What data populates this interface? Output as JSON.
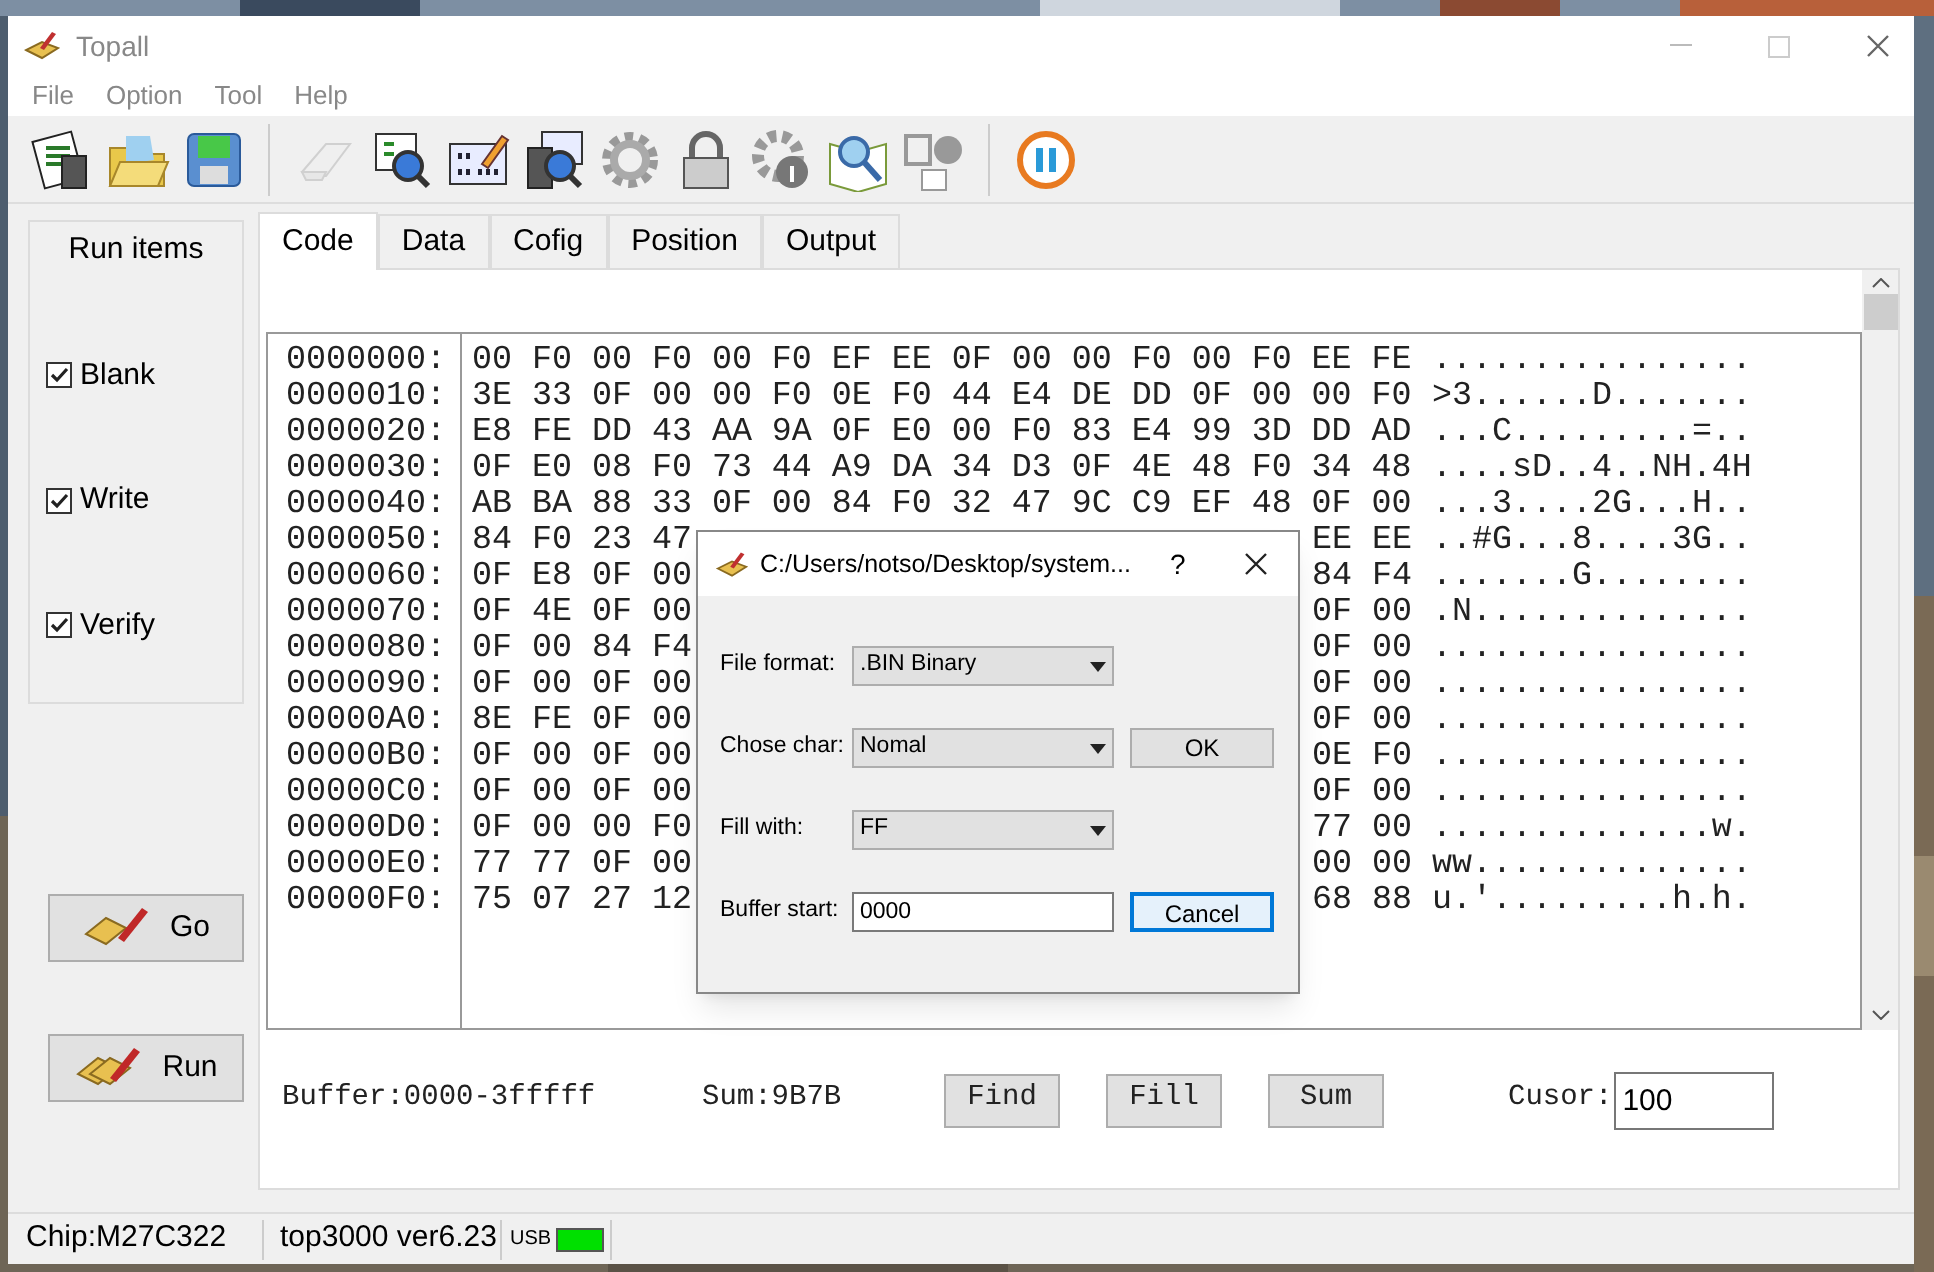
{
  "window": {
    "title": "Topall"
  },
  "menu": [
    "File",
    "Option",
    "Tool",
    "Help"
  ],
  "toolbar": [
    {
      "kind": "chip-list",
      "disabled": false
    },
    {
      "kind": "folder",
      "disabled": false
    },
    {
      "kind": "floppy",
      "disabled": false
    },
    {
      "kind": "separator"
    },
    {
      "kind": "eraser",
      "disabled": true
    },
    {
      "kind": "doc-search",
      "disabled": false
    },
    {
      "kind": "binary-edit",
      "disabled": false
    },
    {
      "kind": "chip-search",
      "disabled": false
    },
    {
      "kind": "gear",
      "disabled": false
    },
    {
      "kind": "lock",
      "disabled": false
    },
    {
      "kind": "gear-info",
      "disabled": false
    },
    {
      "kind": "book-search",
      "disabled": false
    },
    {
      "kind": "logos",
      "disabled": false
    },
    {
      "kind": "separator"
    },
    {
      "kind": "pause",
      "disabled": false
    }
  ],
  "run_items": {
    "title": "Run items",
    "items": [
      {
        "label": "Blank",
        "checked": true
      },
      {
        "label": "Write",
        "checked": true
      },
      {
        "label": "Verify",
        "checked": true
      }
    ]
  },
  "actions": [
    {
      "kind": "go",
      "label": "Go"
    },
    {
      "kind": "run",
      "label": "Run"
    }
  ],
  "tabs": [
    {
      "label": "Code",
      "selected": true
    },
    {
      "label": "Data",
      "selected": false
    },
    {
      "label": "Cofig",
      "selected": false
    },
    {
      "label": "Position",
      "selected": false
    },
    {
      "label": "Output",
      "selected": false
    }
  ],
  "hex_rows": [
    {
      "offset": "0000000:",
      "hex": "00 F0 00 F0 00 F0 EF EE 0F 00 00 F0 00 F0 EE FE",
      "ascii": "................"
    },
    {
      "offset": "0000010:",
      "hex": "3E 33 0F 00 00 F0 0E F0 44 E4 DE DD 0F 00 00 F0",
      "ascii": ">3......D......."
    },
    {
      "offset": "0000020:",
      "hex": "E8 FE DD 43 AA 9A 0F E0 00 F0 83 E4 99 3D DD AD",
      "ascii": "...C.........=.."
    },
    {
      "offset": "0000030:",
      "hex": "0F E0 08 F0 73 44 A9 DA 34 D3 0F 4E 48 F0 34 48",
      "ascii": "....sD..4..NH.4H"
    },
    {
      "offset": "0000040:",
      "hex": "AB BA 88 33 0F 00 84 F0 32 47 9C C9 EF 48 0F 00",
      "ascii": "...3....2G...H.."
    },
    {
      "offset": "0000050:",
      "hex_left": "84 F0 23 47",
      "hex_right": "EE EE",
      "ascii": "..#G...8....3G.."
    },
    {
      "offset": "0000060:",
      "hex_left": "0F E8 0F 00",
      "hex_right": "84 F4",
      "ascii": ".......G........"
    },
    {
      "offset": "0000070:",
      "hex_left": "0F 4E 0F 00",
      "hex_right": "0F 00",
      "ascii": ".N.............."
    },
    {
      "offset": "0000080:",
      "hex_left": "0F 00 84 F4",
      "hex_right": "0F 00",
      "ascii": "................"
    },
    {
      "offset": "0000090:",
      "hex_left": "0F 00 0F 00",
      "hex_right": "0F 00",
      "ascii": "................"
    },
    {
      "offset": "00000A0:",
      "hex_left": "8E FE 0F 00",
      "hex_right": "0F 00",
      "ascii": "................"
    },
    {
      "offset": "00000B0:",
      "hex_left": "0F 00 0F 00",
      "hex_right": "0E F0",
      "ascii": "................"
    },
    {
      "offset": "00000C0:",
      "hex_left": "0F 00 0F 00",
      "hex_right": "0F 00",
      "ascii": "................"
    },
    {
      "offset": "00000D0:",
      "hex_left": "0F 00 00 F0",
      "hex_right": "77 00",
      "ascii": "..............w."
    },
    {
      "offset": "00000E0:",
      "hex_left": "77 77 0F 00",
      "hex_right": "00 00",
      "ascii": "ww.............."
    },
    {
      "offset": "00000F0:",
      "hex_left": "75 07 27 12",
      "hex_right": "68 88",
      "ascii": "u.'.........h.h."
    }
  ],
  "buffer_info": {
    "buffer": "Buffer:0000-3fffff",
    "sum": "Sum:9B7B"
  },
  "buffer_buttons": [
    "Find",
    "Fill",
    "Sum"
  ],
  "cursor": {
    "label": "Cusor:",
    "value": "100"
  },
  "status_bar": {
    "chip": "Chip:M27C322",
    "version": "top3000 ver6.23",
    "usb_label": "USB",
    "usb_connected": true
  },
  "dialog": {
    "title": "C:/Users/notso/Desktop/system...",
    "help": "?",
    "fields": [
      {
        "kind": "select",
        "label": "File format:",
        "value": ".BIN Binary"
      },
      {
        "kind": "select",
        "label": "Chose char:",
        "value": "Nomal"
      },
      {
        "kind": "select",
        "label": "Fill with:",
        "value": "FF"
      },
      {
        "kind": "input",
        "label": "Buffer start:",
        "value": "0000"
      }
    ],
    "buttons": [
      {
        "label": "OK",
        "focused": false
      },
      {
        "label": "Cancel",
        "focused": true
      }
    ]
  }
}
